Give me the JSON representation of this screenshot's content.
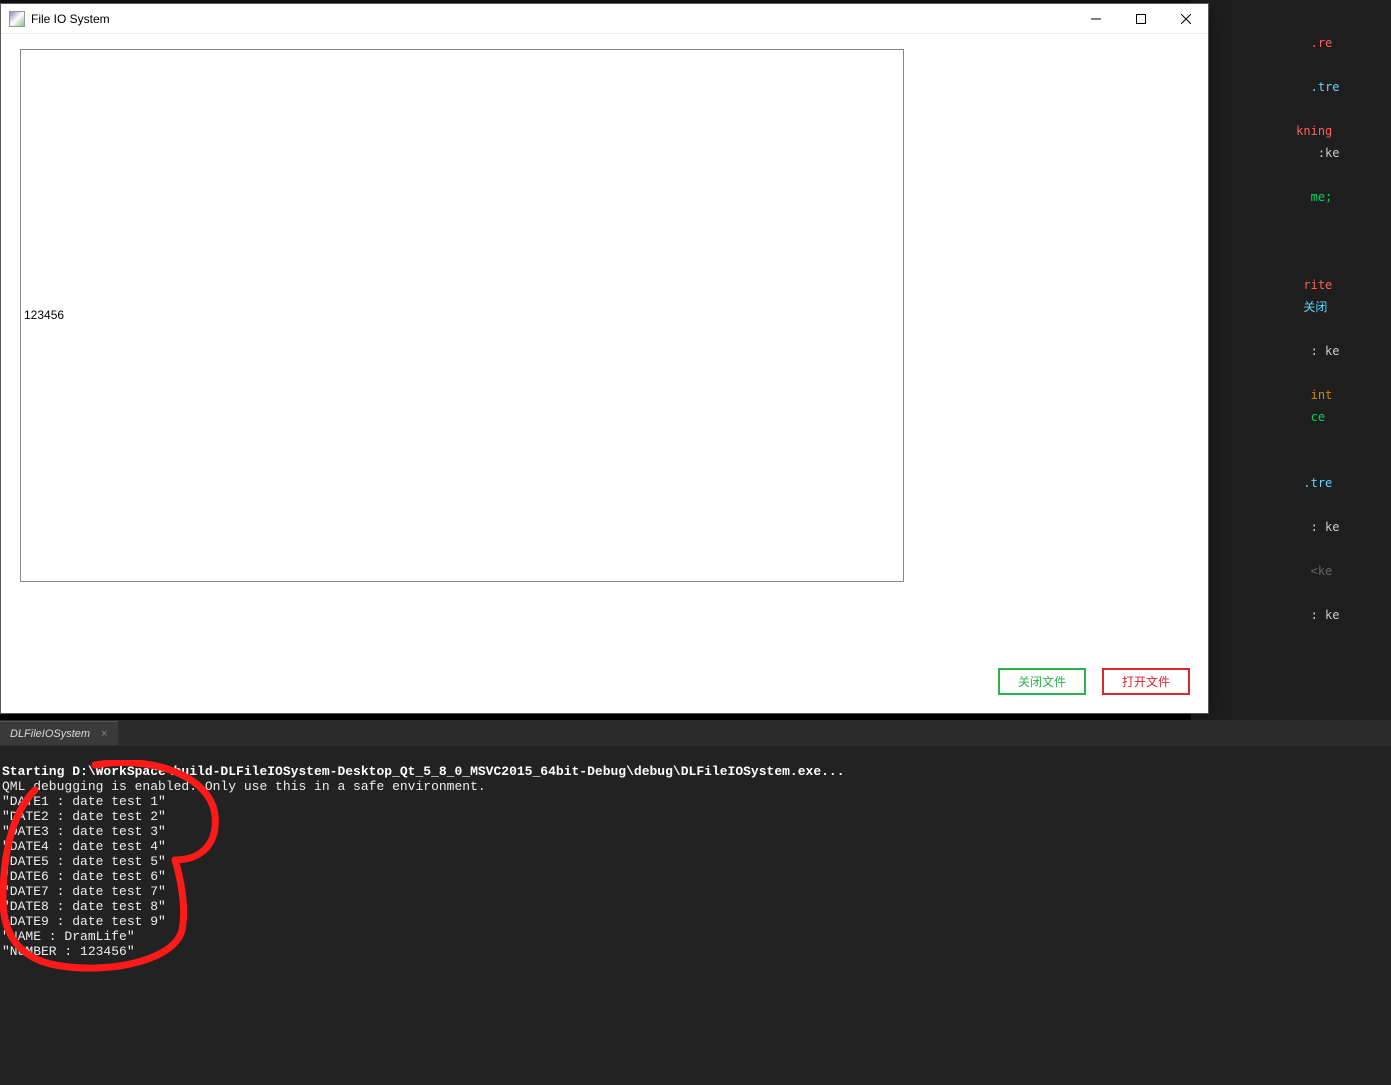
{
  "dialog": {
    "title": "File IO System",
    "text_content": "123456",
    "buttons": {
      "close_file": "关闭文件",
      "open_file": "打开文件"
    }
  },
  "bg_code_fragments": [
    {
      "cls": "c5",
      "t": "                    "
    },
    {
      "cls": "c2",
      "t": "                .re"
    },
    {
      "cls": "",
      "t": "                    "
    },
    {
      "cls": "c1",
      "t": "                .tre"
    },
    {
      "cls": "",
      "t": "                    "
    },
    {
      "cls": "c2",
      "t": "              kning"
    },
    {
      "cls": "",
      "t": "                 :ke"
    },
    {
      "cls": "",
      "t": "                    "
    },
    {
      "cls": "c3",
      "t": "                me;"
    },
    {
      "cls": "",
      "t": "                    "
    },
    {
      "cls": "",
      "t": "                    "
    },
    {
      "cls": "",
      "t": "                    "
    },
    {
      "cls": "c2",
      "t": "               rite"
    },
    {
      "cls": "c1",
      "t": "               关闭"
    },
    {
      "cls": "",
      "t": "                    "
    },
    {
      "cls": "",
      "t": "                : ke"
    },
    {
      "cls": "",
      "t": "                    "
    },
    {
      "cls": "c4",
      "t": "                int"
    },
    {
      "cls": "c3",
      "t": "                ce"
    },
    {
      "cls": "",
      "t": "                    "
    },
    {
      "cls": "",
      "t": "                    "
    },
    {
      "cls": "c1",
      "t": "               .tre"
    },
    {
      "cls": "",
      "t": "                    "
    },
    {
      "cls": "",
      "t": "                : ke"
    },
    {
      "cls": "",
      "t": "                    "
    },
    {
      "cls": "c5",
      "t": "                <ke"
    },
    {
      "cls": "",
      "t": "                    "
    },
    {
      "cls": "",
      "t": "                : ke"
    }
  ],
  "lower_tab": {
    "label": "DLFileIOSystem"
  },
  "console_lines": [
    {
      "bold": true,
      "text": "Starting D:\\WorkSpace\\build-DLFileIOSystem-Desktop_Qt_5_8_0_MSVC2015_64bit-Debug\\debug\\DLFileIOSystem.exe..."
    },
    {
      "bold": false,
      "text": "QML debugging is enabled. Only use this in a safe environment."
    },
    {
      "bold": false,
      "text": "\"DATE1 : date test 1\""
    },
    {
      "bold": false,
      "text": "\"DATE2 : date test 2\""
    },
    {
      "bold": false,
      "text": "\"DATE3 : date test 3\""
    },
    {
      "bold": false,
      "text": "\"DATE4 : date test 4\""
    },
    {
      "bold": false,
      "text": "\"DATE5 : date test 5\""
    },
    {
      "bold": false,
      "text": "\"DATE6 : date test 6\""
    },
    {
      "bold": false,
      "text": "\"DATE7 : date test 7\""
    },
    {
      "bold": false,
      "text": "\"DATE8 : date test 8\""
    },
    {
      "bold": false,
      "text": "\"DATE9 : date test 9\""
    },
    {
      "bold": false,
      "text": "\"NAME : DramLife\""
    },
    {
      "bold": false,
      "text": "\"NUMBER : 123456\""
    }
  ],
  "colors": {
    "btn_green": "#2bb24c",
    "btn_red": "#d9272e",
    "annotation": "#ff1a1a"
  }
}
